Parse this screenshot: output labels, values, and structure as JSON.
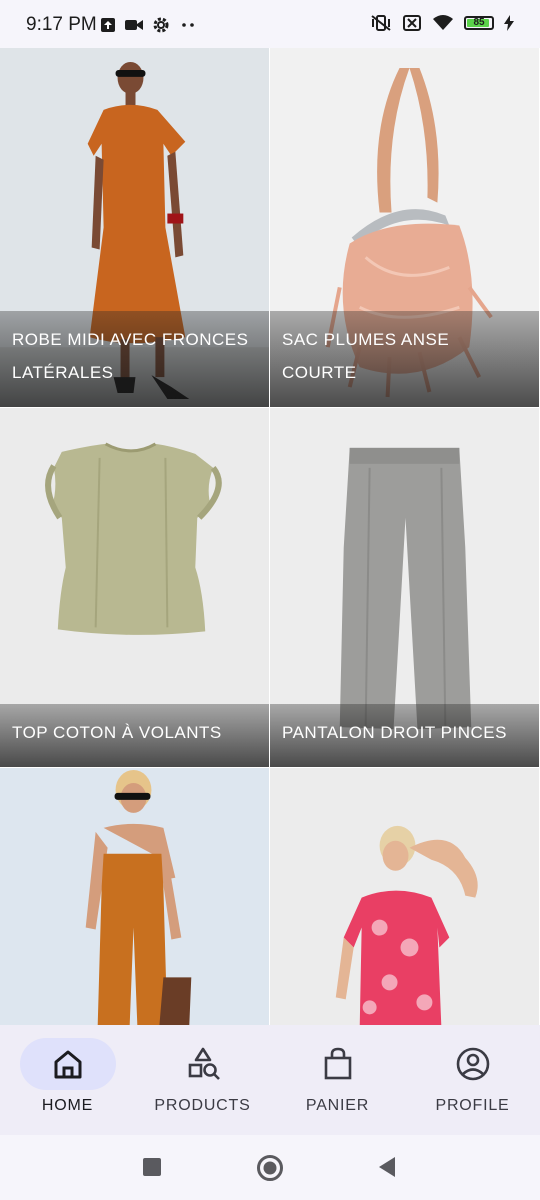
{
  "status": {
    "time": "9:17 PM",
    "battery": "85",
    "battery_level": 0.85
  },
  "products": [
    {
      "title": "ROBE MIDI AVEC FRONCES LATÉRALES",
      "image": "model-in-orange-midi-dress"
    },
    {
      "title": "SAC PLUMES ANSE COURTE",
      "image": "pink-feather-bag"
    },
    {
      "title": "TOP COTON À VOLANTS",
      "image": "khaki-ruffle-top"
    },
    {
      "title": "PANTALON DROIT PINCES",
      "image": "grey-straight-trousers"
    },
    {
      "title": "",
      "image": "model-in-orange-jumpsuit"
    },
    {
      "title": "",
      "image": "model-in-pink-floral-dress"
    }
  ],
  "nav": {
    "home": "HOME",
    "products": "PRODUCTS",
    "panier": "PANIER",
    "profile": "PROFILE",
    "active": "home"
  },
  "colors": {
    "accent_pill": "#dfe1fb",
    "nav_background": "#efedf7"
  }
}
